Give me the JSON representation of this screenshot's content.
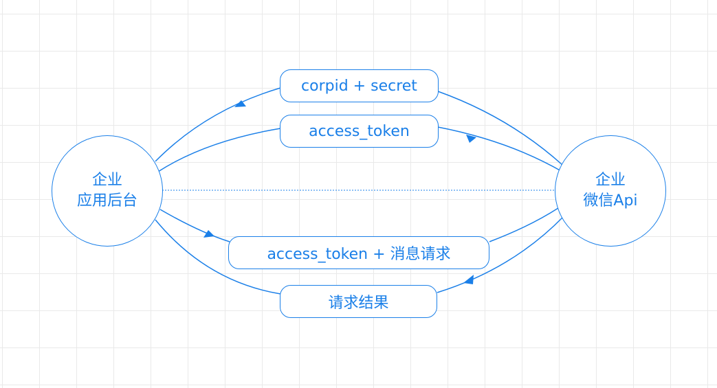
{
  "colors": {
    "accent": "#1a7fe8",
    "grid": "#e9e9e9",
    "background": "#ffffff"
  },
  "nodes": {
    "left": {
      "line1": "企业",
      "line2": "应用后台"
    },
    "right": {
      "line1": "企业",
      "line2": "微信Api"
    }
  },
  "messages": [
    {
      "text": "corpid + secret",
      "direction": "left-to-right"
    },
    {
      "text": "access_token",
      "direction": "right-to-left"
    },
    {
      "text": "access_token + 消息请求",
      "direction": "left-to-right"
    },
    {
      "text": "请求结果",
      "direction": "right-to-left"
    }
  ]
}
